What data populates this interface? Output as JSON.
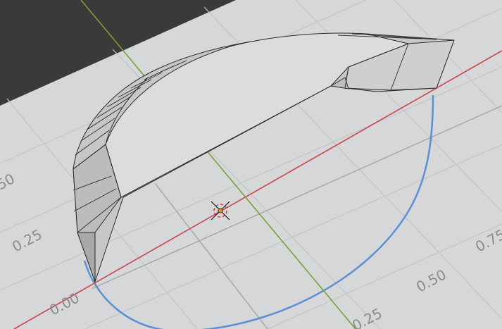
{
  "app": "3D viewport",
  "colors": {
    "background_dark": "#3a3a3a",
    "ground_plane": "#d6d7d9",
    "grid_line": "#bfc0c2",
    "grid_line_major": "#a9aaac",
    "x_axis": "#c8464c",
    "y_axis": "#7aa035",
    "curve": "#5b8fd6",
    "mesh_face_light": "#dcdcdc",
    "mesh_face_mid": "#c9c9c9",
    "mesh_face_dark": "#b4b4b4",
    "mesh_edge": "#2a2a2a",
    "origin_marker": "#f08a24"
  },
  "grid_labels": {
    "zero_left": "0.00",
    "quarter_left": "0.25",
    "half_left": "50",
    "half_right": "0.50",
    "three_quarter_right": "0.75",
    "quarter_bottom": "0.25"
  },
  "icons": {
    "origin": "origin-cursor-icon"
  }
}
